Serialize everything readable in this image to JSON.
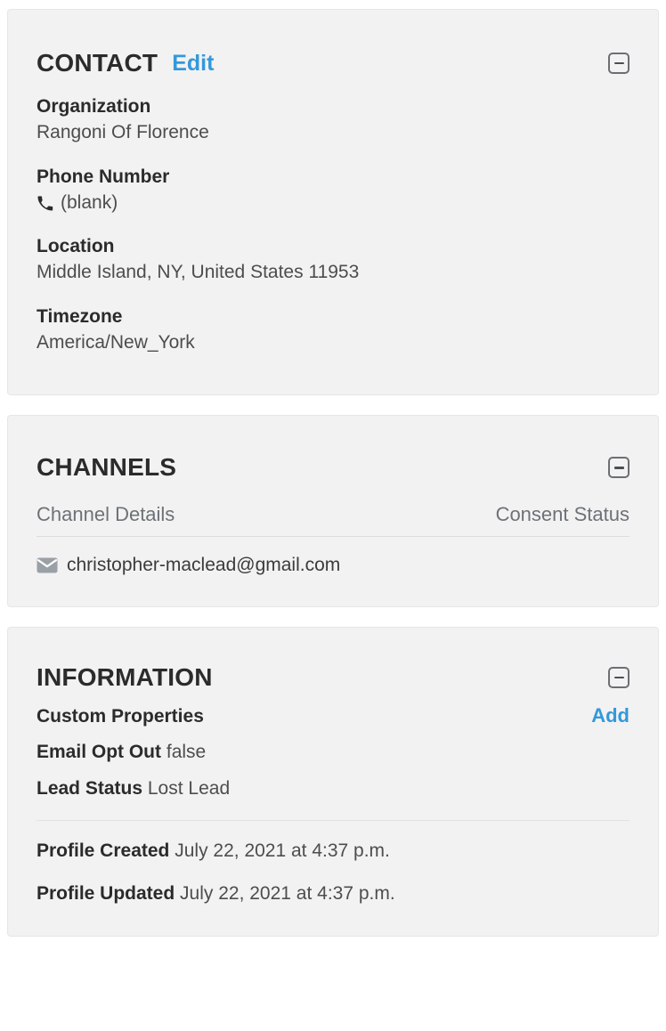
{
  "theme": {
    "page_bg": "#ffffff",
    "card_bg": "#f2f2f2",
    "card_border": "#e6e6e6",
    "link_accent": "#3498db",
    "label_color": "#2b2b2b",
    "value_color": "#4d4d4d",
    "muted_color": "#6d7277"
  },
  "contact": {
    "title": "CONTACT",
    "edit_label": "Edit",
    "collapse_icon": "minus-square-icon",
    "fields": [
      {
        "label": "Organization",
        "value": "Rangoni Of Florence",
        "icon": null
      },
      {
        "label": "Phone Number",
        "value": "(blank)",
        "icon": "phone-icon"
      },
      {
        "label": "Location",
        "value": "Middle Island, NY, United States 11953",
        "icon": null
      },
      {
        "label": "Timezone",
        "value": "America/New_York",
        "icon": null
      }
    ]
  },
  "channels": {
    "title": "CHANNELS",
    "collapse_icon": "minus-square-icon",
    "columns": {
      "details": "Channel Details",
      "consent": "Consent Status"
    },
    "rows": [
      {
        "icon": "envelope-icon",
        "detail": "christopher-maclead@gmail.com",
        "consent": ""
      }
    ]
  },
  "information": {
    "title": "INFORMATION",
    "collapse_icon": "minus-square-icon",
    "custom_properties_label": "Custom Properties",
    "add_label": "Add",
    "properties": [
      {
        "label": "Email Opt Out",
        "value": "false"
      },
      {
        "label": "Lead Status",
        "value": "Lost Lead"
      }
    ],
    "meta": [
      {
        "label": "Profile Created",
        "value": "July 22, 2021 at 4:37 p.m."
      },
      {
        "label": "Profile Updated",
        "value": "July 22, 2021 at 4:37 p.m."
      }
    ]
  }
}
